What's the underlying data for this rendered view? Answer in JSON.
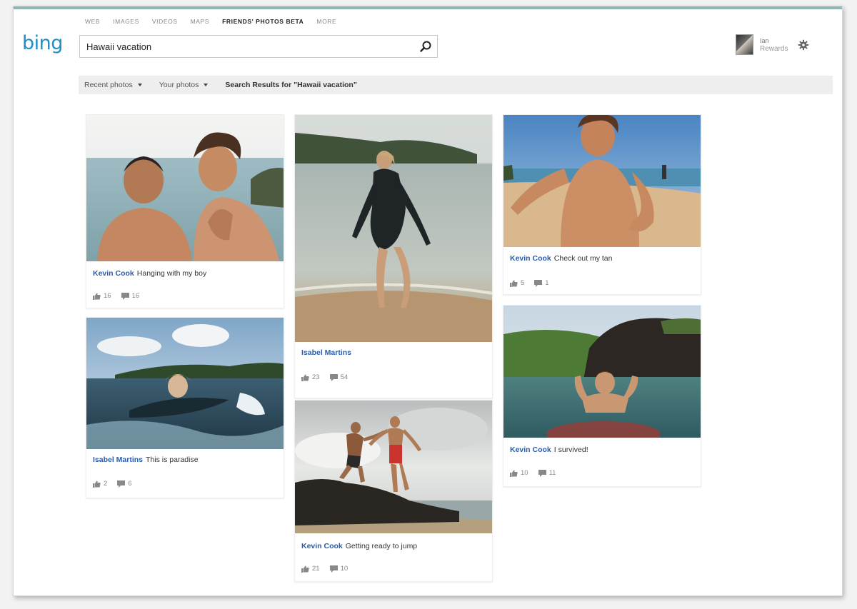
{
  "nav": {
    "items": [
      "WEB",
      "IMAGES",
      "VIDEOS",
      "MAPS",
      "FRIENDS' PHOTOS BETA",
      "MORE"
    ],
    "active": "FRIENDS' PHOTOS BETA"
  },
  "logo": "bing",
  "search": {
    "value": "Hawaii vacation"
  },
  "user": {
    "name": "Ian",
    "rewards": "Rewards"
  },
  "filters": {
    "recent": "Recent photos",
    "yours": "Your photos",
    "title": "Search Results for \"Hawaii vacation\""
  },
  "icons": {
    "search": "search-icon",
    "gear": "gear-icon",
    "like": "thumbs-up-icon",
    "comment": "comment-icon"
  },
  "colors": {
    "brand": "#1e8dc9",
    "author": "#2a5caa"
  },
  "cards": [
    {
      "author": "Kevin Cook",
      "caption": "Hanging with my boy",
      "likes": "16",
      "comments": "16"
    },
    {
      "author": "Isabel Martins",
      "caption": "This is paradise",
      "likes": "2",
      "comments": "6"
    },
    {
      "author": "Isabel Martins",
      "caption": "",
      "likes": "23",
      "comments": "54"
    },
    {
      "author": "Kevin Cook",
      "caption": "Getting ready to jump",
      "likes": "21",
      "comments": "10"
    },
    {
      "author": "Kevin Cook",
      "caption": "Check out my tan",
      "likes": "5",
      "comments": "1"
    },
    {
      "author": "Kevin Cook",
      "caption": "I survived!",
      "likes": "10",
      "comments": "11"
    }
  ]
}
